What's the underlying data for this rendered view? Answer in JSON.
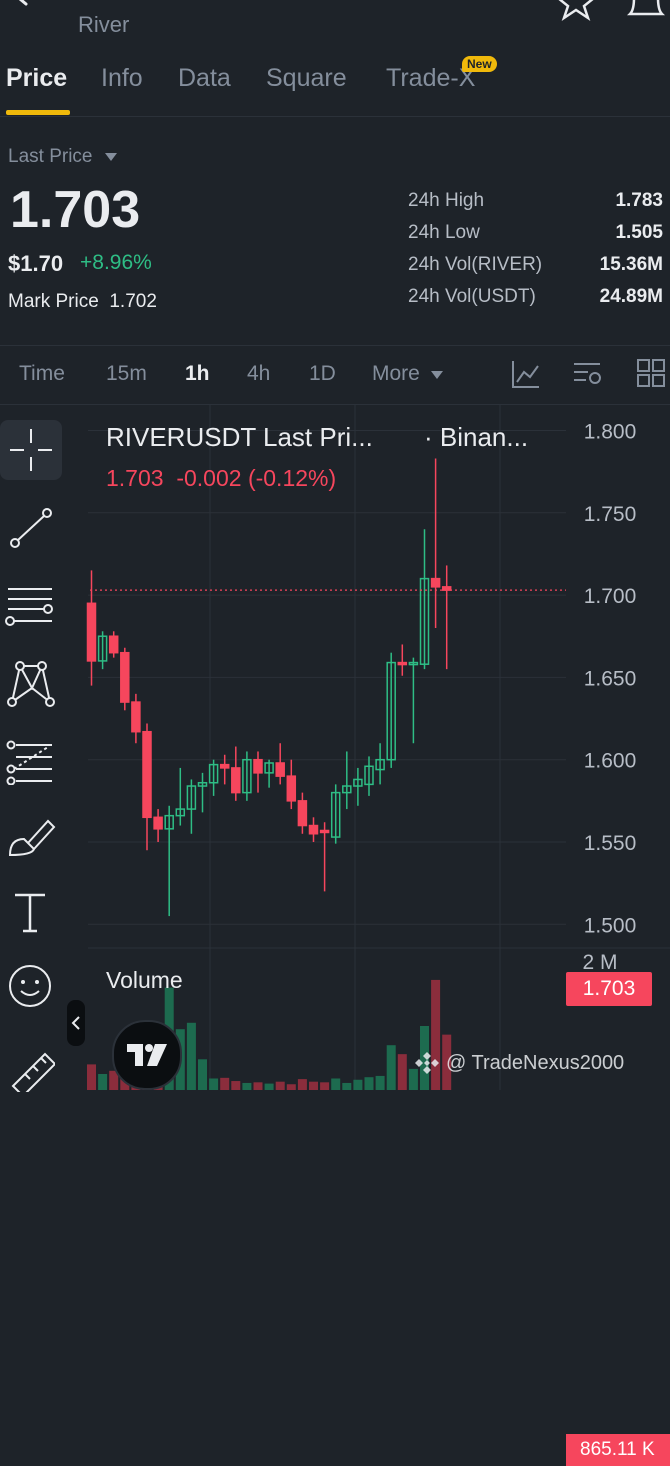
{
  "header": {
    "subtitle": "River"
  },
  "tabs": [
    {
      "label": "Price"
    },
    {
      "label": "Info"
    },
    {
      "label": "Data"
    },
    {
      "label": "Square"
    },
    {
      "label": "Trade-X"
    }
  ],
  "new_badge": "New",
  "price": {
    "last_label": "Last Price",
    "last": "1.703",
    "usd": "$1.70",
    "change_pct": "+8.96%",
    "mark_label": "Mark Price",
    "mark": "1.702"
  },
  "stats": [
    {
      "label": "24h High",
      "value": "1.783"
    },
    {
      "label": "24h Low",
      "value": "1.505"
    },
    {
      "label": "24h Vol(RIVER)",
      "value": "15.36M"
    },
    {
      "label": "24h Vol(USDT)",
      "value": "24.89M"
    }
  ],
  "timeframes": [
    "Time",
    "15m",
    "1h",
    "4h",
    "1D",
    "More"
  ],
  "timeframe_active": "1h",
  "chart_header": {
    "title": "RIVERUSDT Last Pri...",
    "exchange": "· Binan...",
    "readout": "1.703  -0.002 (-0.12%)"
  },
  "volume_label": "Volume",
  "price_tag": "1.703",
  "volume_tag": "865.11 K",
  "volume_axis_top": "2 M",
  "watermark": "@ TradeNexus2000",
  "colors": {
    "bg": "#1e2329",
    "up": "#2ebd85",
    "down": "#f6465d",
    "accent": "#f0b90b"
  },
  "chart_data": {
    "type": "candlestick",
    "yticks": [
      "1.800",
      "1.750",
      "1.700",
      "1.650",
      "1.600",
      "1.550",
      "1.500"
    ],
    "ylim": [
      1.485,
      1.81
    ],
    "candles": [
      {
        "o": 1.695,
        "h": 1.715,
        "l": 1.645,
        "c": 1.66
      },
      {
        "o": 1.66,
        "h": 1.678,
        "l": 1.655,
        "c": 1.675
      },
      {
        "o": 1.675,
        "h": 1.678,
        "l": 1.662,
        "c": 1.665
      },
      {
        "o": 1.665,
        "h": 1.668,
        "l": 1.63,
        "c": 1.635
      },
      {
        "o": 1.635,
        "h": 1.64,
        "l": 1.61,
        "c": 1.617
      },
      {
        "o": 1.617,
        "h": 1.622,
        "l": 1.545,
        "c": 1.565
      },
      {
        "o": 1.565,
        "h": 1.57,
        "l": 1.55,
        "c": 1.558
      },
      {
        "o": 1.558,
        "h": 1.572,
        "l": 1.505,
        "c": 1.566
      },
      {
        "o": 1.566,
        "h": 1.595,
        "l": 1.56,
        "c": 1.57
      },
      {
        "o": 1.57,
        "h": 1.588,
        "l": 1.555,
        "c": 1.584
      },
      {
        "o": 1.584,
        "h": 1.592,
        "l": 1.568,
        "c": 1.586
      },
      {
        "o": 1.586,
        "h": 1.6,
        "l": 1.578,
        "c": 1.597
      },
      {
        "o": 1.597,
        "h": 1.603,
        "l": 1.585,
        "c": 1.595
      },
      {
        "o": 1.595,
        "h": 1.608,
        "l": 1.575,
        "c": 1.58
      },
      {
        "o": 1.58,
        "h": 1.605,
        "l": 1.575,
        "c": 1.6
      },
      {
        "o": 1.6,
        "h": 1.605,
        "l": 1.58,
        "c": 1.592
      },
      {
        "o": 1.592,
        "h": 1.6,
        "l": 1.583,
        "c": 1.598
      },
      {
        "o": 1.598,
        "h": 1.61,
        "l": 1.585,
        "c": 1.59
      },
      {
        "o": 1.59,
        "h": 1.6,
        "l": 1.57,
        "c": 1.575
      },
      {
        "o": 1.575,
        "h": 1.58,
        "l": 1.555,
        "c": 1.56
      },
      {
        "o": 1.56,
        "h": 1.565,
        "l": 1.55,
        "c": 1.555
      },
      {
        "o": 1.557,
        "h": 1.562,
        "l": 1.52,
        "c": 1.556
      },
      {
        "o": 1.553,
        "h": 1.585,
        "l": 1.549,
        "c": 1.58
      },
      {
        "o": 1.58,
        "h": 1.605,
        "l": 1.57,
        "c": 1.584
      },
      {
        "o": 1.584,
        "h": 1.595,
        "l": 1.572,
        "c": 1.588
      },
      {
        "o": 1.585,
        "h": 1.602,
        "l": 1.578,
        "c": 1.596
      },
      {
        "o": 1.594,
        "h": 1.61,
        "l": 1.585,
        "c": 1.6
      },
      {
        "o": 1.6,
        "h": 1.665,
        "l": 1.595,
        "c": 1.659
      },
      {
        "o": 1.659,
        "h": 1.67,
        "l": 1.651,
        "c": 1.658
      },
      {
        "o": 1.658,
        "h": 1.662,
        "l": 1.61,
        "c": 1.659
      },
      {
        "o": 1.658,
        "h": 1.74,
        "l": 1.655,
        "c": 1.71
      },
      {
        "o": 1.71,
        "h": 1.783,
        "l": 1.68,
        "c": 1.705
      },
      {
        "o": 1.705,
        "h": 1.718,
        "l": 1.655,
        "c": 1.703
      }
    ],
    "volume_ylim": [
      0,
      2000000
    ],
    "volumes": [
      400000,
      250000,
      300000,
      320000,
      280000,
      360000,
      400000,
      1600000,
      950000,
      1050000,
      480000,
      180000,
      190000,
      140000,
      110000,
      120000,
      100000,
      130000,
      90000,
      170000,
      130000,
      120000,
      180000,
      110000,
      160000,
      200000,
      220000,
      700000,
      560000,
      330000,
      1000000,
      1720000,
      865110
    ]
  }
}
